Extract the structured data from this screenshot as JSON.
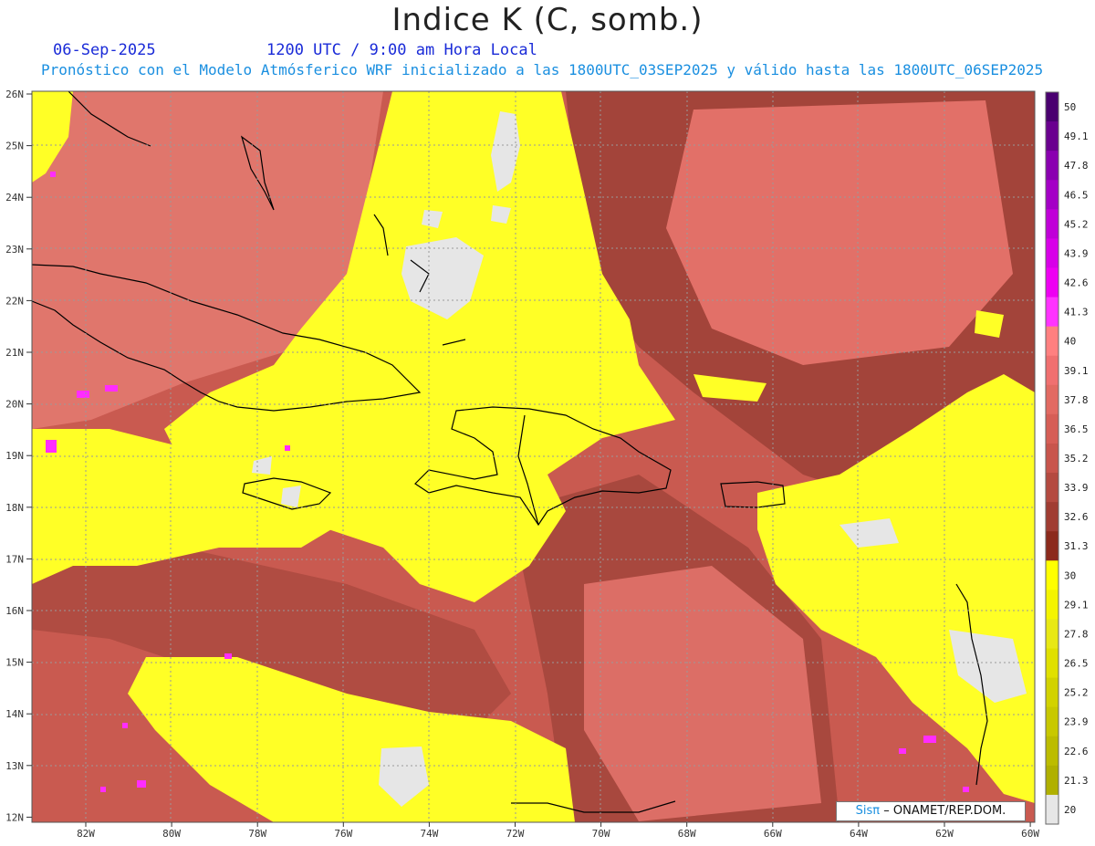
{
  "header": {
    "title": "Indice K (C, somb.)",
    "date": "06-Sep-2025",
    "time": "1200 UTC / 9:00 am Hora Local",
    "subtitle": "Pronóstico con el Modelo Atmósferico WRF inicializado a las 1800UTC_03SEP2025 y válido hasta las  1800UTC_06SEP2025"
  },
  "map": {
    "lat_labels": [
      "26N",
      "25N",
      "24N",
      "23N",
      "22N",
      "21N",
      "20N",
      "19N",
      "18N",
      "17N",
      "16N",
      "15N",
      "14N",
      "13N",
      "12N"
    ],
    "lon_labels": [
      "82W",
      "80W",
      "78W",
      "76W",
      "74W",
      "72W",
      "70W",
      "68W",
      "66W",
      "64W",
      "62W",
      "60W"
    ]
  },
  "colorbar": {
    "labels": [
      "50",
      "49.1",
      "47.8",
      "46.5",
      "45.2",
      "43.9",
      "42.6",
      "41.3",
      "40",
      "39.1",
      "37.8",
      "36.5",
      "35.2",
      "33.9",
      "32.6",
      "31.3",
      "30",
      "29.1",
      "27.8",
      "26.5",
      "25.2",
      "23.9",
      "22.6",
      "21.3",
      "20"
    ],
    "colors": [
      "#4a0070",
      "#6a008f",
      "#8a00b0",
      "#a400c6",
      "#c000d8",
      "#d800e8",
      "#ee00f2",
      "#ff33ff",
      "#ff8080",
      "#f07070",
      "#e26a62",
      "#d65e56",
      "#c8554c",
      "#b44a40",
      "#a03c32",
      "#8c2a1c",
      "#ffff00",
      "#f4f400",
      "#e8e814",
      "#e0e000",
      "#d2d200",
      "#c8c800",
      "#bcbc00",
      "#b0b000",
      "#e6e6e6"
    ]
  },
  "colors": {
    "k_high": "#d06058",
    "k_mid": "#a0443a",
    "k_low_yellow": "#ffff26",
    "k_none": "#e6e6e6",
    "coast": "#000000"
  },
  "footer": {
    "brand": "Sisπ",
    "text": "– ONAMET/REP.DOM."
  }
}
